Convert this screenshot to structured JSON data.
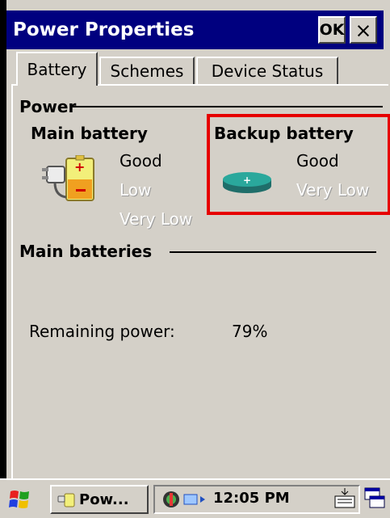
{
  "window": {
    "title": "Power Properties",
    "ok_label": "OK",
    "close_label": "×"
  },
  "tabs": [
    {
      "label": "Battery",
      "active": true
    },
    {
      "label": "Schemes",
      "active": false
    },
    {
      "label": "Device Status",
      "active": false
    }
  ],
  "power_group": {
    "label": "Power",
    "main_battery": {
      "heading": "Main battery",
      "levels": [
        "Good",
        "Low",
        "Very Low"
      ],
      "current": "Good",
      "icon": "plug-battery-icon"
    },
    "backup_battery": {
      "heading": "Backup battery",
      "levels": [
        "Good",
        "Very Low"
      ],
      "current": "Good",
      "icon": "coin-cell-battery-icon"
    }
  },
  "main_batteries_group": {
    "label": "Main batteries",
    "remaining_label": "Remaining power:",
    "remaining_value": "79%"
  },
  "taskbar": {
    "start_icon": "windows-flag-icon",
    "task_label": "Pow...",
    "clock": "12:05 PM",
    "keyboard_icon": "keyboard-icon",
    "switch_icon": "window-switch-icon"
  },
  "colors": {
    "title_bar": "#00007f",
    "highlight_border": "#e60000",
    "dialog_face": "#d4d0c8"
  }
}
